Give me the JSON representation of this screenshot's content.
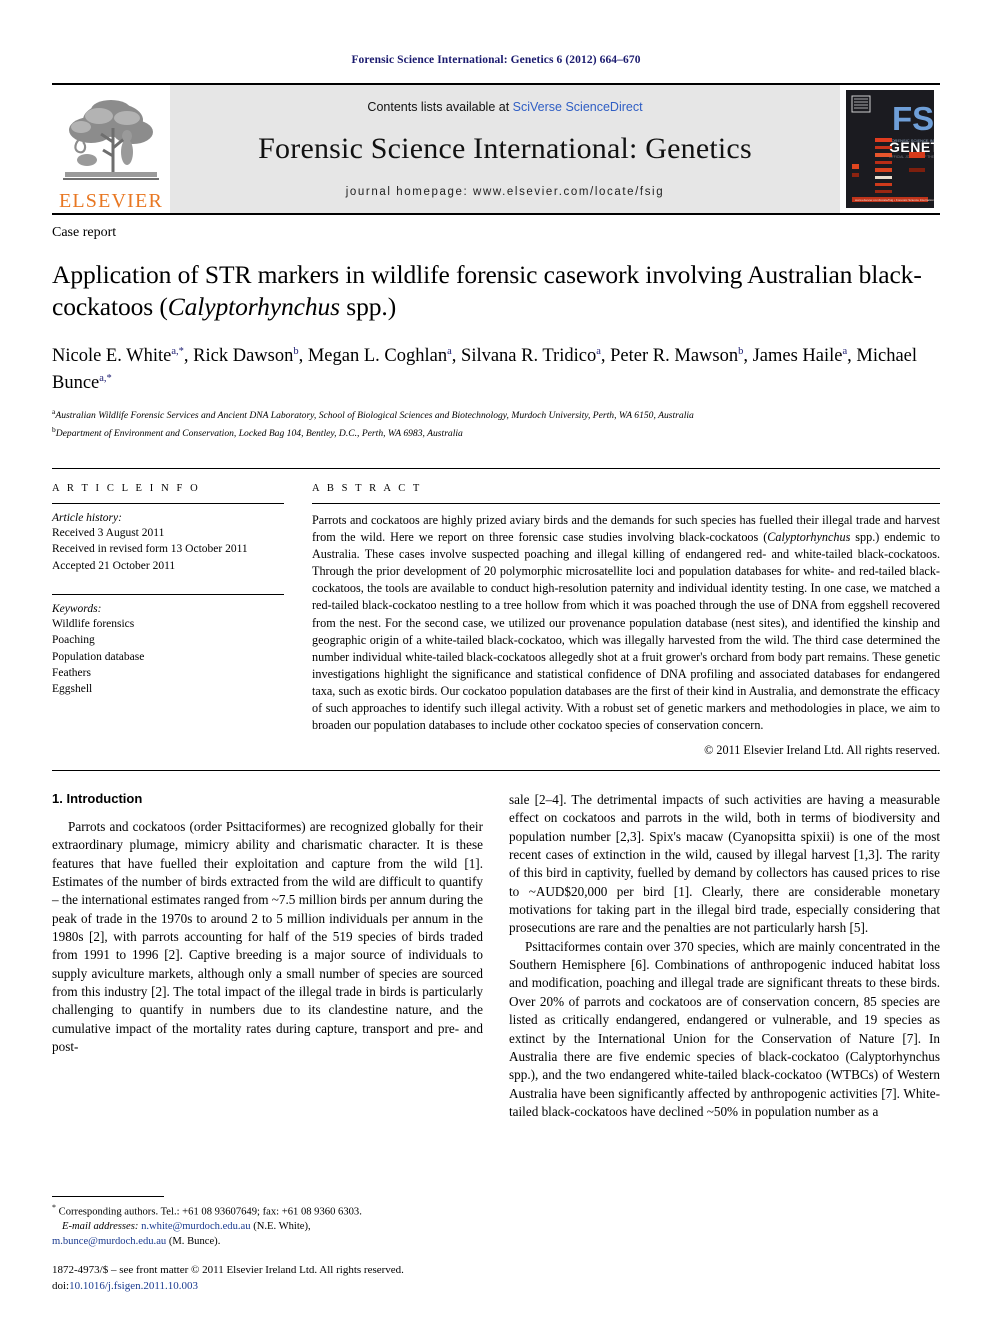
{
  "running_head": "Forensic Science International: Genetics 6 (2012) 664–670",
  "masthead": {
    "contents_prefix": "Contents lists available at",
    "contents_link": "SciVerse ScienceDirect",
    "journal_title": "Forensic Science International: Genetics",
    "homepage": "journal homepage: www.elsevier.com/locate/fsig",
    "publisher_wordmark": "ELSEVIER",
    "publisher_color": "#E87722",
    "cover": {
      "title_main": "FSI",
      "title_sub": "GENETICS",
      "title_color": "#6f9fd8"
    }
  },
  "article": {
    "doctype": "Case report",
    "title_part1": "Application of STR markers in wildlife forensic casework involving Australian black-cockatoos (",
    "title_italic": "Calyptorhynchus",
    "title_part2": " spp.)",
    "authors": [
      {
        "name": "Nicole E. White",
        "sup": "a,*"
      },
      {
        "name": "Rick Dawson",
        "sup": "b"
      },
      {
        "name": "Megan L. Coghlan",
        "sup": "a"
      },
      {
        "name": "Silvana R. Tridico",
        "sup": "a"
      },
      {
        "name": "Peter R. Mawson",
        "sup": "b"
      },
      {
        "name": "James Haile",
        "sup": "a"
      },
      {
        "name": "Michael Bunce",
        "sup": "a,*"
      }
    ],
    "affiliations": [
      {
        "mark": "a",
        "text": "Australian Wildlife Forensic Services and Ancient DNA Laboratory, School of Biological Sciences and Biotechnology, Murdoch University, Perth, WA 6150, Australia"
      },
      {
        "mark": "b",
        "text": "Department of Environment and Conservation, Locked Bag 104, Bentley, D.C., Perth, WA 6983, Australia"
      }
    ]
  },
  "article_info": {
    "heading": "A R T I C L E    I N F O",
    "history_label": "Article history:",
    "history": [
      "Received 3 August 2011",
      "Received in revised form 13 October 2011",
      "Accepted 21 October 2011"
    ],
    "keywords_label": "Keywords:",
    "keywords": [
      "Wildlife forensics",
      "Poaching",
      "Population database",
      "Feathers",
      "Eggshell"
    ]
  },
  "abstract": {
    "heading": "A B S T R A C T",
    "text_before_italic": "Parrots and cockatoos are highly prized aviary birds and the demands for such species has fuelled their illegal trade and harvest from the wild. Here we report on three forensic case studies involving black-cockatoos (",
    "italic_term": "Calyptorhynchus",
    "text_after_italic": " spp.) endemic to Australia. These cases involve suspected poaching and illegal killing of endangered red- and white-tailed black-cockatoos. Through the prior development of 20 polymorphic microsatellite loci and population databases for white- and red-tailed black-cockatoos, the tools are available to conduct high-resolution paternity and individual identity testing. In one case, we matched a red-tailed black-cockatoo nestling to a tree hollow from which it was poached through the use of DNA from eggshell recovered from the nest. For the second case, we utilized our provenance population database (nest sites), and identified the kinship and geographic origin of a white-tailed black-cockatoo, which was illegally harvested from the wild. The third case determined the number individual white-tailed black-cockatoos allegedly shot at a fruit grower's orchard from body part remains. These genetic investigations highlight the significance and statistical confidence of DNA profiling and associated databases for endangered taxa, such as exotic birds. Our cockatoo population databases are the first of their kind in Australia, and demonstrate the efficacy of such approaches to identify such illegal activity. With a robust set of genetic markers and methodologies in place, we aim to broaden our population databases to include other cockatoo species of conservation concern.",
    "copyright": "© 2011 Elsevier Ireland Ltd. All rights reserved."
  },
  "body": {
    "section_title": "1. Introduction",
    "left_paragraph": "Parrots and cockatoos (order Psittaciformes) are recognized globally for their extraordinary plumage, mimicry ability and charismatic character. It is these features that have fuelled their exploitation and capture from the wild [1]. Estimates of the number of birds extracted from the wild are difficult to quantify – the international estimates ranged from ~7.5 million birds per annum during the peak of trade in the 1970s to around 2 to 5 million individuals per annum in the 1980s [2], with parrots accounting for half of the 519 species of birds traded from 1991 to 1996 [2]. Captive breeding is a major source of individuals to supply aviculture markets, although only a small number of species are sourced from this industry [2]. The total impact of the illegal trade in birds is particularly challenging to quantify in numbers due to its clandestine nature, and the cumulative impact of the mortality rates during capture, transport and pre- and post-",
    "right_paragraph_1": "sale [2–4]. The detrimental impacts of such activities are having a measurable effect on cockatoos and parrots in the wild, both in terms of biodiversity and population number [2,3]. Spix's macaw (Cyanopsitta spixii) is one of the most recent cases of extinction in the wild, caused by illegal harvest [1,3]. The rarity of this bird in captivity, fuelled by demand by collectors has caused prices to rise to ~AUD$20,000 per bird [1]. Clearly, there are considerable monetary motivations for taking part in the illegal bird trade, especially considering that prosecutions are rare and the penalties are not particularly harsh [5].",
    "right_paragraph_2": "Psittaciformes contain over 370 species, which are mainly concentrated in the Southern Hemisphere [6]. Combinations of anthropogenic induced habitat loss and modification, poaching and illegal trade are significant threats to these birds. Over 20% of parrots and cockatoos are of conservation concern, 85 species are listed as critically endangered, endangered or vulnerable, and 19 species as extinct by the International Union for the Conservation of Nature [7]. In Australia there are five endemic species of black-cockatoo (Calyptorhynchus spp.), and the two endangered white-tailed black-cockatoo (WTBCs) of Western Australia have been significantly affected by anthropogenic activities [7]. White-tailed black-cockatoos have declined ~50% in population number as a"
  },
  "footnotes": {
    "corresponding": "Corresponding authors. Tel.: +61 08 93607649; fax: +61 08 9360 6303.",
    "email_label": "E-mail addresses:",
    "email_1": "n.white@murdoch.edu.au",
    "email_1_owner": "(N.E. White),",
    "email_2": "m.bunce@murdoch.edu.au",
    "email_2_owner": "(M. Bunce).",
    "issn_line": "1872-4973/$ – see front matter © 2011 Elsevier Ireland Ltd. All rights reserved.",
    "doi_label": "doi:",
    "doi_value": "10.1016/j.fsigen.2011.10.003"
  }
}
